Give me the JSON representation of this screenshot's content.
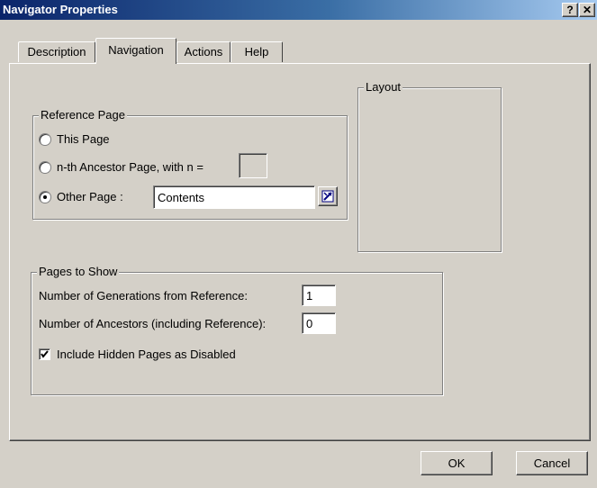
{
  "window": {
    "title": "Navigator Properties",
    "help_glyph": "?",
    "close_glyph": "✕"
  },
  "tabs": [
    {
      "label": "Description"
    },
    {
      "label": "Navigation"
    },
    {
      "label": "Actions"
    },
    {
      "label": "Help"
    }
  ],
  "reference_page": {
    "legend": "Reference Page",
    "options": [
      {
        "label": "This Page",
        "selected": false
      },
      {
        "label": "n-th Ancestor Page, with n =",
        "selected": false
      },
      {
        "label": "Other Page :",
        "selected": true
      }
    ],
    "n_value": "",
    "other_page_value": "Contents"
  },
  "layout": {
    "legend": "Layout"
  },
  "pages_to_show": {
    "legend": "Pages to Show",
    "generations_label": "Number of Generations from Reference:",
    "generations_value": "1",
    "ancestors_label": "Number of Ancestors (including Reference):",
    "ancestors_value": "0",
    "include_hidden_label": "Include Hidden Pages as Disabled",
    "include_hidden_checked": true
  },
  "buttons": {
    "ok": "OK",
    "cancel": "Cancel"
  }
}
